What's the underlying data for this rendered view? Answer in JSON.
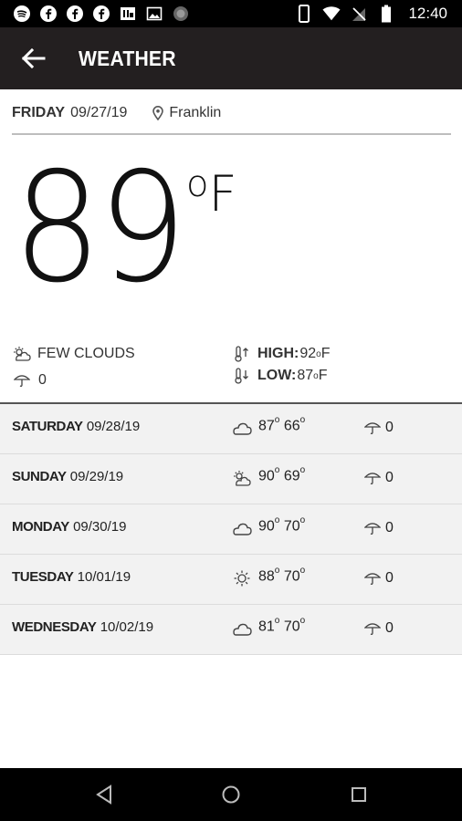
{
  "status_bar": {
    "time": "12:40",
    "left_icons": [
      "spotify-icon",
      "facebook-icon",
      "facebook-icon",
      "facebook-icon",
      "app-icon",
      "image-icon",
      "record-icon"
    ],
    "right_icons": [
      "vibrate-icon",
      "wifi-icon",
      "no-signal-icon",
      "battery-icon"
    ]
  },
  "toolbar": {
    "title": "WEATHER",
    "back_icon": "arrow-left-icon"
  },
  "current": {
    "day": "FRIDAY",
    "date": "09/27/19",
    "location": "Franklin",
    "temperature": "89",
    "unit_degree": "o",
    "unit_letter": "F",
    "condition": "FEW CLOUDS",
    "precip": "0",
    "high_label": "HIGH:",
    "high_value": "92",
    "low_label": "LOW:",
    "low_value": "87",
    "deg_symbol": "o",
    "deg_unit": "F"
  },
  "forecast": [
    {
      "day": "SATURDAY",
      "date": "09/28/19",
      "icon": "cloud-icon",
      "high": "87",
      "low": "66",
      "precip": "0"
    },
    {
      "day": "SUNDAY",
      "date": "09/29/19",
      "icon": "partly-cloudy-icon",
      "high": "90",
      "low": "69",
      "precip": "0"
    },
    {
      "day": "MONDAY",
      "date": "09/30/19",
      "icon": "cloud-icon",
      "high": "90",
      "low": "70",
      "precip": "0"
    },
    {
      "day": "TUESDAY",
      "date": "10/01/19",
      "icon": "sun-icon",
      "high": "88",
      "low": "70",
      "precip": "0"
    },
    {
      "day": "WEDNESDAY",
      "date": "10/02/19",
      "icon": "cloud-icon",
      "high": "81",
      "low": "70",
      "precip": "0"
    }
  ],
  "degree_mark": "o",
  "nav": {
    "back": "nav-back-icon",
    "home": "nav-home-icon",
    "recents": "nav-recents-icon"
  }
}
